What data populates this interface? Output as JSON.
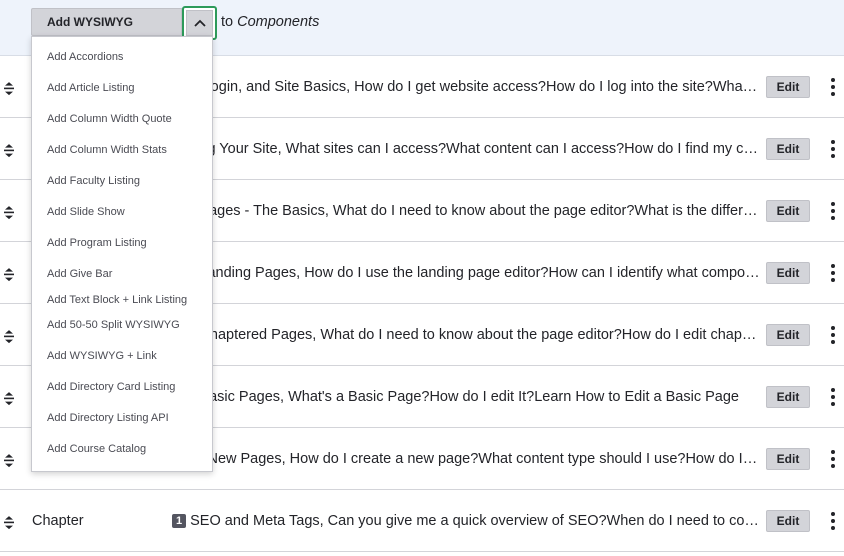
{
  "header": {
    "text_prefix": "to ",
    "text_italic": "Components"
  },
  "dropdown": {
    "selected_label": "Add WYSIWYG",
    "chevron_icon": "chevron-up-icon",
    "focus_color": "#2d9a5a",
    "items": [
      {
        "label": "Add Accordions"
      },
      {
        "label": "Add Article Listing"
      },
      {
        "label": "Add Column Width Quote"
      },
      {
        "label": "Add Column Width Stats"
      },
      {
        "label": "Add Faculty Listing"
      },
      {
        "label": "Add Slide Show"
      },
      {
        "label": "Add Program Listing"
      },
      {
        "label": "Add Give Bar"
      },
      {
        "label": "Add Text Block + Link Listing"
      },
      {
        "label": "Add 50-50 Split WYSIWYG"
      },
      {
        "label": "Add WYSIWYG + Link"
      },
      {
        "label": "Add Directory Card Listing"
      },
      {
        "label": "Add Directory Listing API"
      },
      {
        "label": "Add Course Catalog"
      }
    ]
  },
  "rows": [
    {
      "label": "",
      "badge": "",
      "text": "ess, Login, and Site Basics, How do I get website access?How do I log into the site?What do I need to know?",
      "edit_label": "Edit"
    },
    {
      "label": "",
      "badge": "",
      "text": "naging Your Site, What sites can I access?What content can I access?How do I find my content?",
      "edit_label": "Edit"
    },
    {
      "label": "",
      "badge": "",
      "text": "ting Pages - The Basics, What do I need to know about the page editor?What is the difference?",
      "edit_label": "Edit"
    },
    {
      "label": "",
      "badge": "",
      "text": "ting Landing Pages, How do I use the landing page editor?How can I identify what components?",
      "edit_label": "Edit"
    },
    {
      "label": "",
      "badge": "",
      "text": "ting Chaptered Pages, What do I need to know about the page editor?How do I edit chapters?",
      "edit_label": "Edit"
    },
    {
      "label": "",
      "badge": "",
      "text": "ting Basic Pages, What's a Basic Page?How do I edit It?Learn How to Edit a Basic Page",
      "edit_label": "Edit"
    },
    {
      "label": "",
      "badge": "",
      "text": "ating New Pages, How do I create a new page?What content type should I use?How do I publish?",
      "edit_label": "Edit"
    },
    {
      "label": "Chapter",
      "badge": "1",
      "text": "SEO and Meta Tags, Can you give me a quick overview of SEO?When do I need to configure meta tags?",
      "edit_label": "Edit"
    }
  ]
}
